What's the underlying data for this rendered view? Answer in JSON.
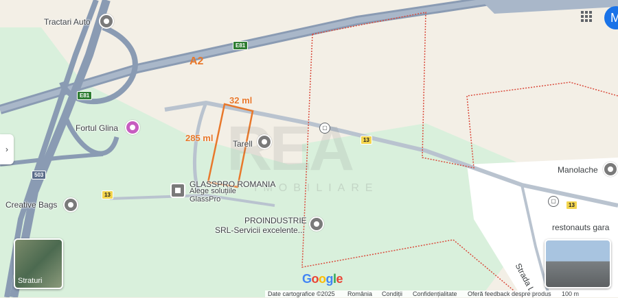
{
  "colors": {
    "highway": "#8a9bb3",
    "green": "#d9f0dc",
    "orange": "#e8782b",
    "boundary": "#d9493a"
  },
  "road_labels": {
    "a2": "A2",
    "e81_top": "E81",
    "e81_left": "E81",
    "r503": "503",
    "r13_a": "13",
    "r13_b": "13",
    "r13_c": "13"
  },
  "plot": {
    "top": "32 ml",
    "side": "285 ml"
  },
  "places": {
    "tractari": "Tractari Auto",
    "fortul": "Fortul Glina",
    "tarell": "Tarell",
    "glasspro": "GLASSPRO ROMANIA",
    "glasspro_sub1": "Alege soluțiile",
    "glasspro_sub2": "GlassPro",
    "creative": "Creative Bags",
    "proind1": "PROINDUSTRIE",
    "proind2": "SRL-Servicii excelente...",
    "manolache": "Manolache",
    "restonauts": "restonauts gara",
    "strada": "Strada Lu"
  },
  "watermark": {
    "main": "REA",
    "sub": "IMOBILIARE"
  },
  "controls": {
    "layers": "Straturi",
    "avatar": "M",
    "logo": "Google",
    "side_arrow": "›"
  },
  "footer": {
    "data": "Date cartografice ©2025",
    "country": "România",
    "terms": "Condiții",
    "privacy": "Confidențialitate",
    "feedback": "Oferă feedback despre produs",
    "scale": "100 m"
  }
}
